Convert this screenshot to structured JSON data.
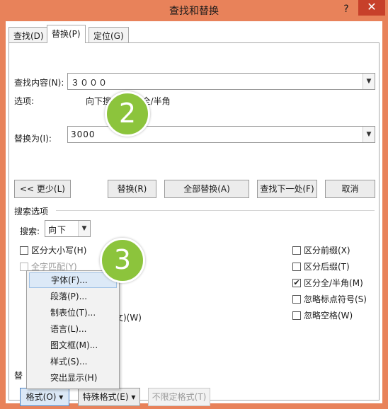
{
  "window": {
    "title": "查找和替换",
    "help": "?",
    "close": "✕"
  },
  "tabs": [
    {
      "label": "查找(D)"
    },
    {
      "label": "替换(P)"
    },
    {
      "label": "定位(G)"
    }
  ],
  "find": {
    "label": "查找内容(N):",
    "value": "３０００"
  },
  "options": {
    "label": "选项:",
    "value": "向下搜索, 区分全/半角"
  },
  "replace": {
    "label": "替换为(I):",
    "value": "3000"
  },
  "buttons": {
    "less": "<< 更少(L)",
    "replace": "替换(R)",
    "replace_all": "全部替换(A)",
    "find_next": "查找下一处(F)",
    "cancel": "取消"
  },
  "search_options": {
    "title": "搜索选项",
    "search_label": "搜索:",
    "search_value": "向下"
  },
  "checkboxes_left": [
    {
      "label": "区分大小写(H)",
      "checked": false,
      "disabled": false
    },
    {
      "label": "全字匹配(Y)",
      "checked": false,
      "disabled": true
    }
  ],
  "partial_hidden": {
    "text": "文)(W)"
  },
  "checkboxes_right": [
    {
      "label": "区分前缀(X)",
      "checked": false
    },
    {
      "label": "区分后缀(T)",
      "checked": false
    },
    {
      "label": "区分全/半角(M)",
      "checked": true
    },
    {
      "label": "忽略标点符号(S)",
      "checked": false
    },
    {
      "label": "忽略空格(W)",
      "checked": false
    }
  ],
  "format_menu": [
    {
      "label": "字体(F)..."
    },
    {
      "label": "段落(P)..."
    },
    {
      "label": "制表位(T)..."
    },
    {
      "label": "语言(L)..."
    },
    {
      "label": "图文框(M)..."
    },
    {
      "label": "样式(S)..."
    },
    {
      "label": "突出显示(H)"
    }
  ],
  "replace_section_fragment": "替",
  "bottom_buttons": {
    "format": "格式(O) ▾",
    "special": "特殊格式(E) ▾",
    "no_format": "不限定格式(T)"
  },
  "callouts": {
    "two": "2",
    "three": "3"
  },
  "colors": {
    "titlebar": "#e8825a",
    "close": "#c7402a",
    "callout": "#8cc43c"
  }
}
